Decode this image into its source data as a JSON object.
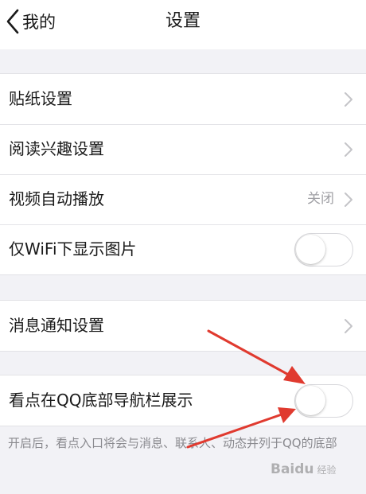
{
  "nav": {
    "back_label": "我的",
    "title": "设置"
  },
  "groups": [
    {
      "items": [
        {
          "label": "贴纸设置",
          "control": "chevron"
        },
        {
          "label": "阅读兴趣设置",
          "control": "chevron"
        },
        {
          "label": "视频自动播放",
          "value": "关闭",
          "control": "chevron"
        },
        {
          "label": "仅WiFi下显示图片",
          "control": "toggle",
          "on": false
        }
      ]
    },
    {
      "items": [
        {
          "label": "消息通知设置",
          "control": "chevron"
        }
      ]
    },
    {
      "items": [
        {
          "label": "看点在QQ底部导航栏展示",
          "control": "toggle",
          "on": false
        }
      ]
    }
  ],
  "footnote": "开启后，看点入口将会与消息、联系人、动态并列于QQ的底部",
  "annotation": {
    "arrow_color": "#e03a2f",
    "arrow_count": 2
  },
  "watermark": {
    "text": "Baidu",
    "sub": "经验"
  },
  "colors": {
    "background": "#f2f2f6",
    "separator": "#e4e4e8",
    "secondary_text": "#8a8a8f",
    "value_text": "#a0a0a5"
  }
}
